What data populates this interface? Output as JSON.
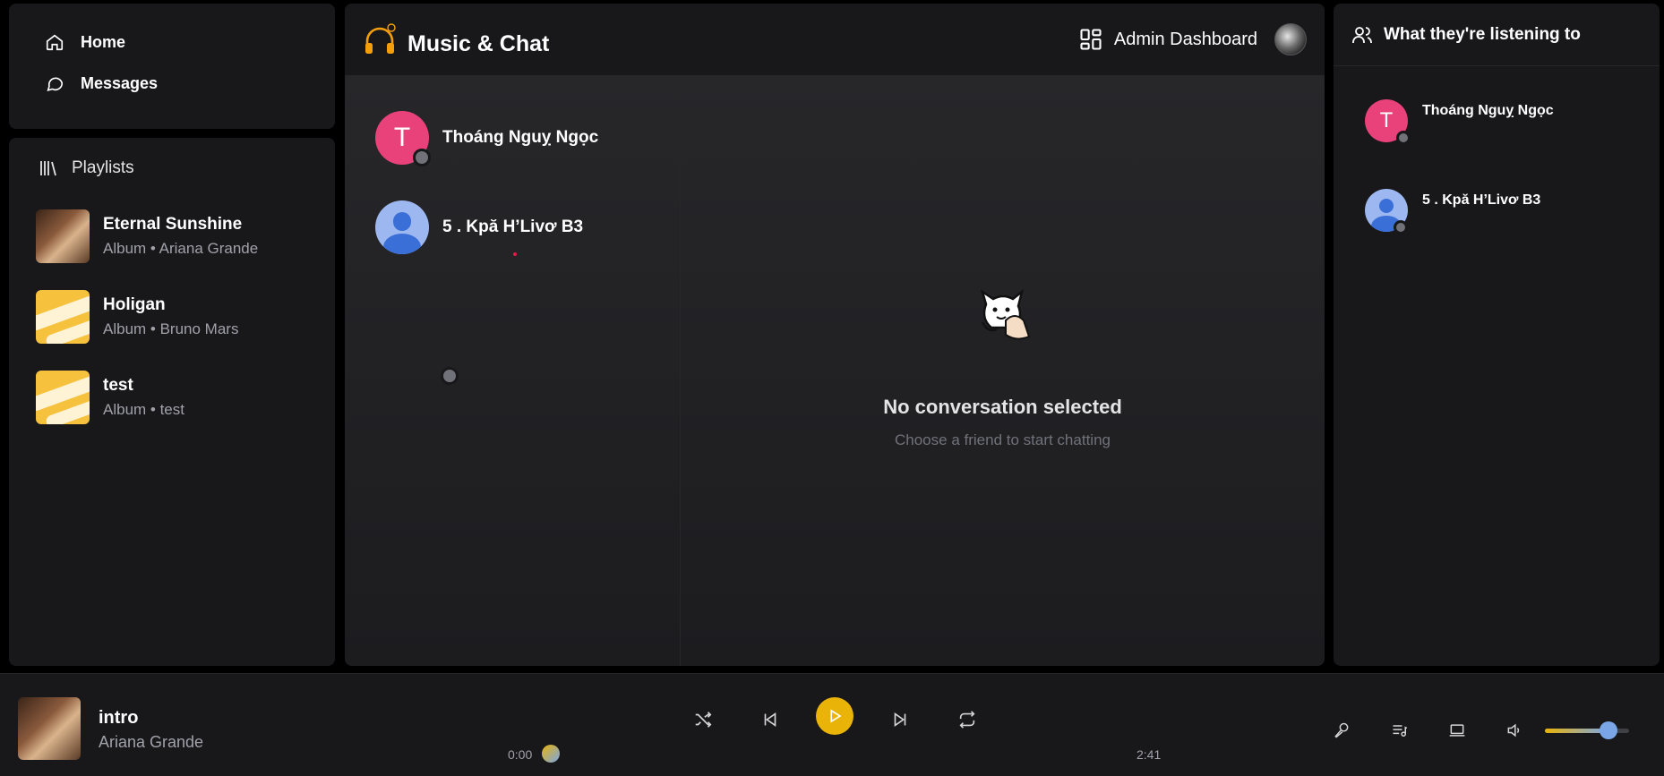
{
  "nav": {
    "home_label": "Home",
    "messages_label": "Messages"
  },
  "playlists": {
    "header": "Playlists",
    "items": [
      {
        "title": "Eternal Sunshine",
        "subtitle": "Album • Ariana Grande"
      },
      {
        "title": "Holigan",
        "subtitle": "Album • Bruno Mars"
      },
      {
        "title": "test",
        "subtitle": "Album • test"
      }
    ]
  },
  "header": {
    "app_title": "Music & Chat",
    "admin_label": "Admin Dashboard"
  },
  "conversations": [
    {
      "initial": "T",
      "name": "Thoáng Nguỵ Ngọc",
      "avatar": "letter",
      "color": "#e9427a",
      "status": "offline"
    },
    {
      "initial": "",
      "name": "5 . Kpă H’Livơ B3",
      "avatar": "default-user",
      "color": "#9db8f0",
      "status": "offline"
    }
  ],
  "empty_state": {
    "title": "No conversation selected",
    "subtitle": "Choose a friend to start chatting"
  },
  "friends": {
    "header": "What they're listening to",
    "items": [
      {
        "initial": "T",
        "name": "Thoáng Nguỵ Ngọc"
      },
      {
        "initial": "",
        "name": "5 . Kpă H’Livơ B3"
      }
    ]
  },
  "player": {
    "title": "intro",
    "artist": "Ariana Grande",
    "current_time": "0:00",
    "duration": "2:41",
    "progress": 0,
    "volume": 0.75
  },
  "colors": {
    "accent": "#eab308",
    "panel": "#18181b",
    "background": "#000000",
    "muted": "#a1a1aa"
  }
}
